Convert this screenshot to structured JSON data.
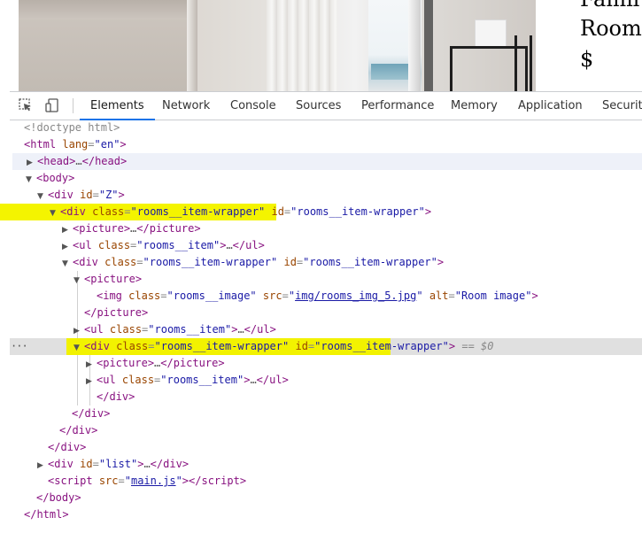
{
  "page_preview": {
    "text_lines": [
      "Famil",
      "Room",
      "$"
    ]
  },
  "devtools": {
    "toolbar": {
      "tabs": [
        {
          "label": "Elements",
          "active": true
        },
        {
          "label": "Network",
          "active": false
        },
        {
          "label": "Console",
          "active": false
        },
        {
          "label": "Sources",
          "active": false
        },
        {
          "label": "Performance",
          "active": false
        },
        {
          "label": "Memory",
          "active": false
        },
        {
          "label": "Application",
          "active": false
        },
        {
          "label": "Security",
          "active": false
        }
      ]
    },
    "tree": {
      "doctype": "<!doctype html>",
      "html_tag": "html",
      "lang_attr": "lang",
      "lang_val": "\"en\"",
      "head_tag": "head",
      "body_tag": "body",
      "div_tag": "div",
      "id_attr": "id",
      "z_val": "\"Z\"",
      "class_attr": "class",
      "wrapper_val": "\"rooms__item-wrapper\"",
      "picture_tag": "picture",
      "ul_tag": "ul",
      "item_val": "\"rooms__item\"",
      "img_tag": "img",
      "image_val": "\"rooms__image\"",
      "src_attr": "src",
      "img_src": "img/rooms_img_5.jpg",
      "alt_attr": "alt",
      "alt_val": "\"Room image\"",
      "ellipsis": "…",
      "selected_marker": "== $0",
      "list_val": "\"list\"",
      "script_tag": "script",
      "script_src": "main.js",
      "row_dots": "···"
    }
  }
}
